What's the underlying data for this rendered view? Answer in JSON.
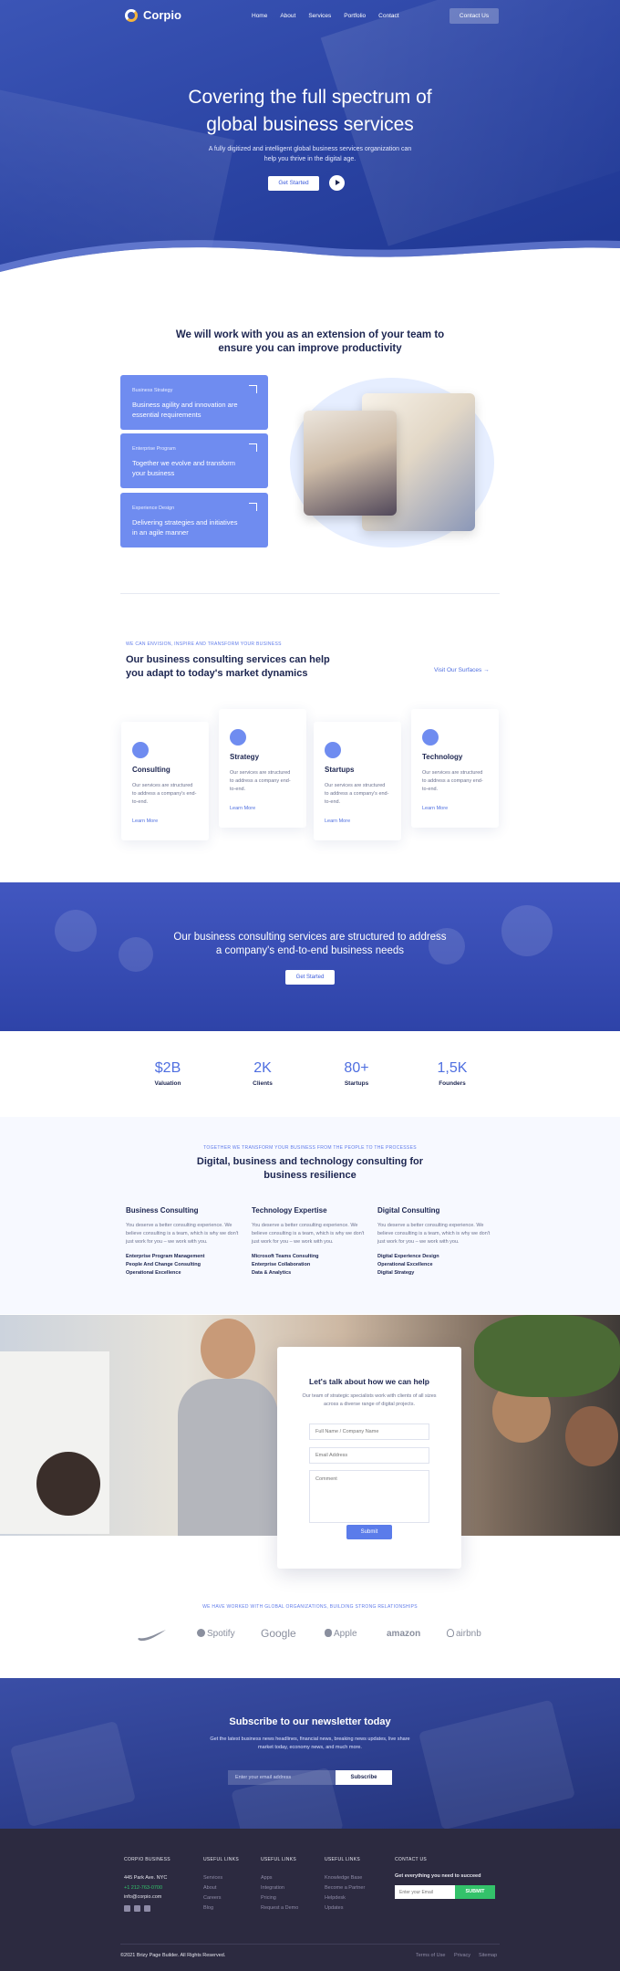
{
  "header": {
    "logo": "Corpio",
    "nav": [
      "Home",
      "About",
      "Services",
      "Portfolio",
      "Contact"
    ],
    "contact_button": "Contact Us"
  },
  "hero": {
    "title_line1": "Covering the full spectrum of",
    "title_line2": "global business services",
    "subtitle": "A fully digitized and intelligent global business services organization can help you thrive in the digital age.",
    "cta": "Get Started"
  },
  "partner": {
    "title_line1": "We will work with you as an extension of your team to",
    "title_line2": "ensure you can improve productivity",
    "cards": [
      {
        "tag": "Business Strategy",
        "text": "Business agility and innovation are essential requirements"
      },
      {
        "tag": "Enterprise Program",
        "text": "Together we evolve and transform your business"
      },
      {
        "tag": "Experience Design",
        "text": "Delivering strategies and initiatives in an agile manner"
      }
    ]
  },
  "services": {
    "tag": "WE CAN ENVISION, INSPIRE AND TRANSFORM YOUR BUSINESS",
    "title_line1": "Our business consulting services can help",
    "title_line2": "you adapt to today's market dynamics",
    "link": "Visit Our Surfaces →",
    "cards": [
      {
        "name": "Consulting",
        "desc": "Our services are structured to address a company's end-to-end.",
        "link": "Learn More"
      },
      {
        "name": "Strategy",
        "desc": "Our services are structured to address a company end-to-end.",
        "link": "Learn More"
      },
      {
        "name": "Startups",
        "desc": "Our services are structured to address a company's end-to-end.",
        "link": "Learn More"
      },
      {
        "name": "Technology",
        "desc": "Our services are structured to address a company end-to-end.",
        "link": "Learn More"
      }
    ]
  },
  "band": {
    "title_line1": "Our business consulting services are structured to address",
    "title_line2": "a company's end-to-end business needs",
    "cta": "Get Started"
  },
  "stats": [
    {
      "value": "$2B",
      "label": "Valuation"
    },
    {
      "value": "2K",
      "label": "Clients"
    },
    {
      "value": "80+",
      "label": "Startups"
    },
    {
      "value": "1,5K",
      "label": "Founders"
    }
  ],
  "consulting": {
    "tag": "TOGETHER WE TRANSFORM YOUR BUSINESS FROM THE PEOPLE TO THE PROCESSES",
    "title_line1": "Digital, business and technology consulting for",
    "title_line2": "business resilience",
    "columns": [
      {
        "title": "Business Consulting",
        "desc": "You deserve a better consulting experience. We believe consulting is a team, which is why we don't just work for you – we work with you.",
        "items": [
          "Enterprise Program Management",
          "People And Change Consulting",
          "Operational Excellence"
        ]
      },
      {
        "title": "Technology Expertise",
        "desc": "You deserve a better consulting experience. We believe consulting is a team, which is why we don't just work for you – we work with you.",
        "items": [
          "Microsoft Teams Consulting",
          "Enterprise Collaboration",
          "Data & Analytics"
        ]
      },
      {
        "title": "Digital Consulting",
        "desc": "You deserve a better consulting experience. We believe consulting is a team, which is why we don't just work for you – we work with you.",
        "items": [
          "Digital Experience Design",
          "Operational Excellence",
          "Digital Strategy"
        ]
      }
    ]
  },
  "contact_form": {
    "title": "Let's talk about how we can help",
    "desc": "Our team of strategic specialists work with clients of all sizes across a diverse range of digital projects.",
    "name_placeholder": "Full Name / Company Name",
    "email_placeholder": "Email Address",
    "comment_placeholder": "Comment",
    "submit": "Submit"
  },
  "logos": {
    "tag": "WE HAVE WORKED WITH GLOBAL ORGANIZATIONS, BUILDING STRONG RELATIONSHIPS",
    "brands": [
      "Spotify",
      "Google",
      "Apple",
      "amazon",
      "airbnb"
    ]
  },
  "newsletter": {
    "title": "Subscribe to our newsletter today",
    "desc": "Get the latest business news headlines, financial news, breaking news updates, live share market today, economy news, and much more.",
    "placeholder": "Enter your email address",
    "button": "Subscribe"
  },
  "footer": {
    "company_heading": "CORPIO BUSINESS",
    "address": "445 Park Ave. NYC",
    "phone": "+1 212-763-0700",
    "email": "info@corpio.com",
    "col2_heading": "USEFUL LINKS",
    "col2": [
      "Services",
      "About",
      "Careers",
      "Blog"
    ],
    "col3_heading": "USEFUL LINKS",
    "col3": [
      "Apps",
      "Integration",
      "Pricing",
      "Request a Demo"
    ],
    "col4_heading": "USEFUL LINKS",
    "col4": [
      "Knowledge Base",
      "Become a Partner",
      "Helpdesk",
      "Updates"
    ],
    "contact_heading": "CONTACT US",
    "contact_text": "Get everything you need to succeed",
    "input_placeholder": "Enter your Email",
    "submit": "SUBMIT",
    "copyright": "©2021 Brizy Page Builder. All Rights Reserved.",
    "bottom_links": [
      "Terms of Use",
      "Privacy",
      "Sitemap"
    ]
  },
  "colors": {
    "primary": "#3b5bdb",
    "accent_card": "#6f8cf0",
    "footer_bg": "#2c2a40",
    "submit_green": "#33c26a"
  }
}
